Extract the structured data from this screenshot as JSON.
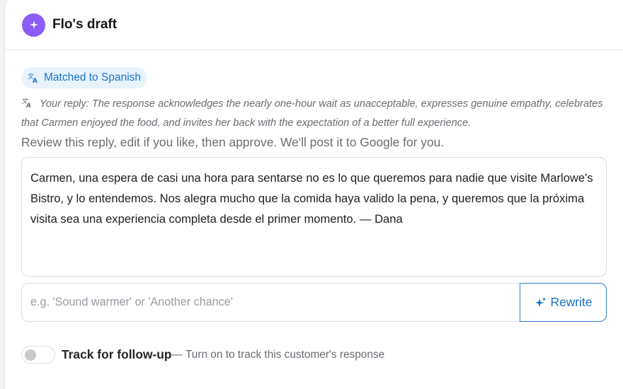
{
  "header": {
    "title": "Flo's draft"
  },
  "language_pill": {
    "label": "Matched to Spanish"
  },
  "summary": {
    "text": "Your reply: The response acknowledges the nearly one-hour wait as unacceptable, expresses genuine empathy, celebrates that Carmen enjoyed the food, and invites her back with the expectation of a better full experience."
  },
  "instructions": "Review this reply, edit if you like, then approve. We'll post it to Google for you.",
  "reply": {
    "text": "Carmen, una espera de casi una hora para sentarse no es lo que queremos para nadie que visite Marlowe's Bistro, y lo entendemos. Nos alegra mucho que la comida haya valido la pena, y queremos que la próxima visita sea una experiencia completa desde el primer momento. — Dana"
  },
  "rewrite": {
    "placeholder": "e.g. 'Sound warmer' or 'Another chance'",
    "button_label": "Rewrite"
  },
  "follow_up": {
    "label": "Track for follow-up",
    "hint": "— Turn on to track this customer's response",
    "enabled": false
  },
  "colors": {
    "accent": "#1a73c8",
    "brand": "#8b5cf6",
    "pill_bg": "#e8f3fd"
  }
}
